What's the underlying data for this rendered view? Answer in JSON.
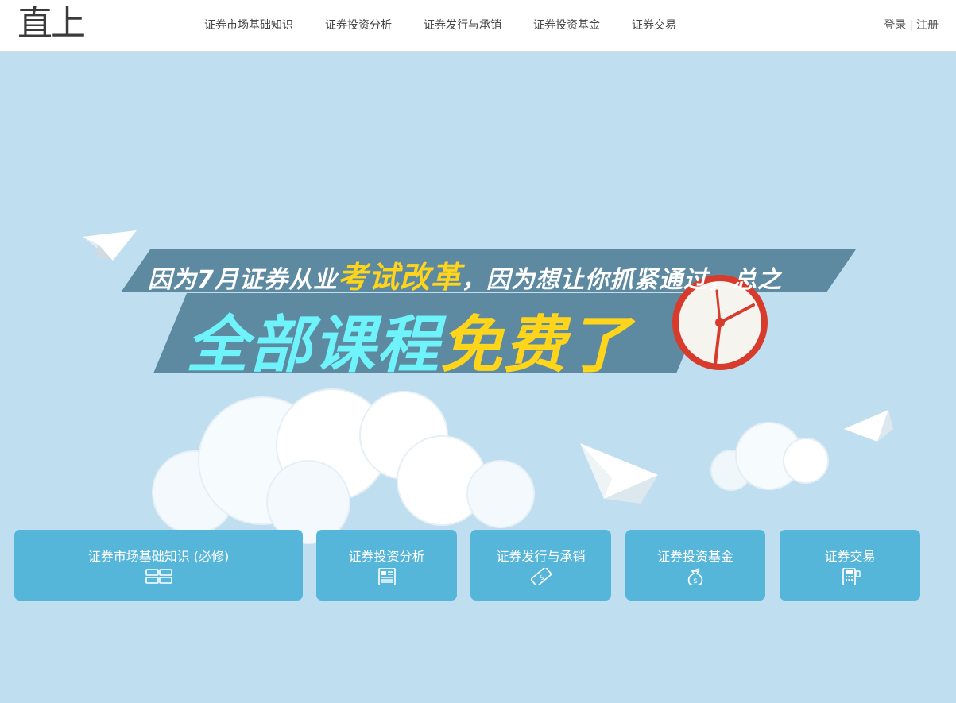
{
  "header": {
    "logo": "直上",
    "nav": [
      "证券市场基础知识",
      "证券投资分析",
      "证券发行与承销",
      "证券投资基金",
      "证券交易"
    ],
    "login": "登录",
    "separator": "|",
    "register": "注册"
  },
  "banner": {
    "line1_prefix": "因为7月证券从业",
    "line1_highlight": "考试改革",
    "line1_suffix": "，因为想让你抓紧通过，总之",
    "line2_prefix": "全部课程",
    "line2_highlight": "免费了"
  },
  "categories": [
    {
      "label": "证券市场基础知识 (必修)",
      "icon": "grid-icon"
    },
    {
      "label": "证券投资分析",
      "icon": "document-icon"
    },
    {
      "label": "证券发行与承销",
      "icon": "ticket-icon"
    },
    {
      "label": "证券投资基金",
      "icon": "money-bag-icon"
    },
    {
      "label": "证券交易",
      "icon": "calculator-icon"
    }
  ],
  "colors": {
    "background": "#bfdff0",
    "card": "#56b6da",
    "ribbon": "#5e8aa1",
    "highlight": "#ffd51c",
    "title_cyan": "#6ef3fb",
    "clock_red": "#d83a2c"
  }
}
